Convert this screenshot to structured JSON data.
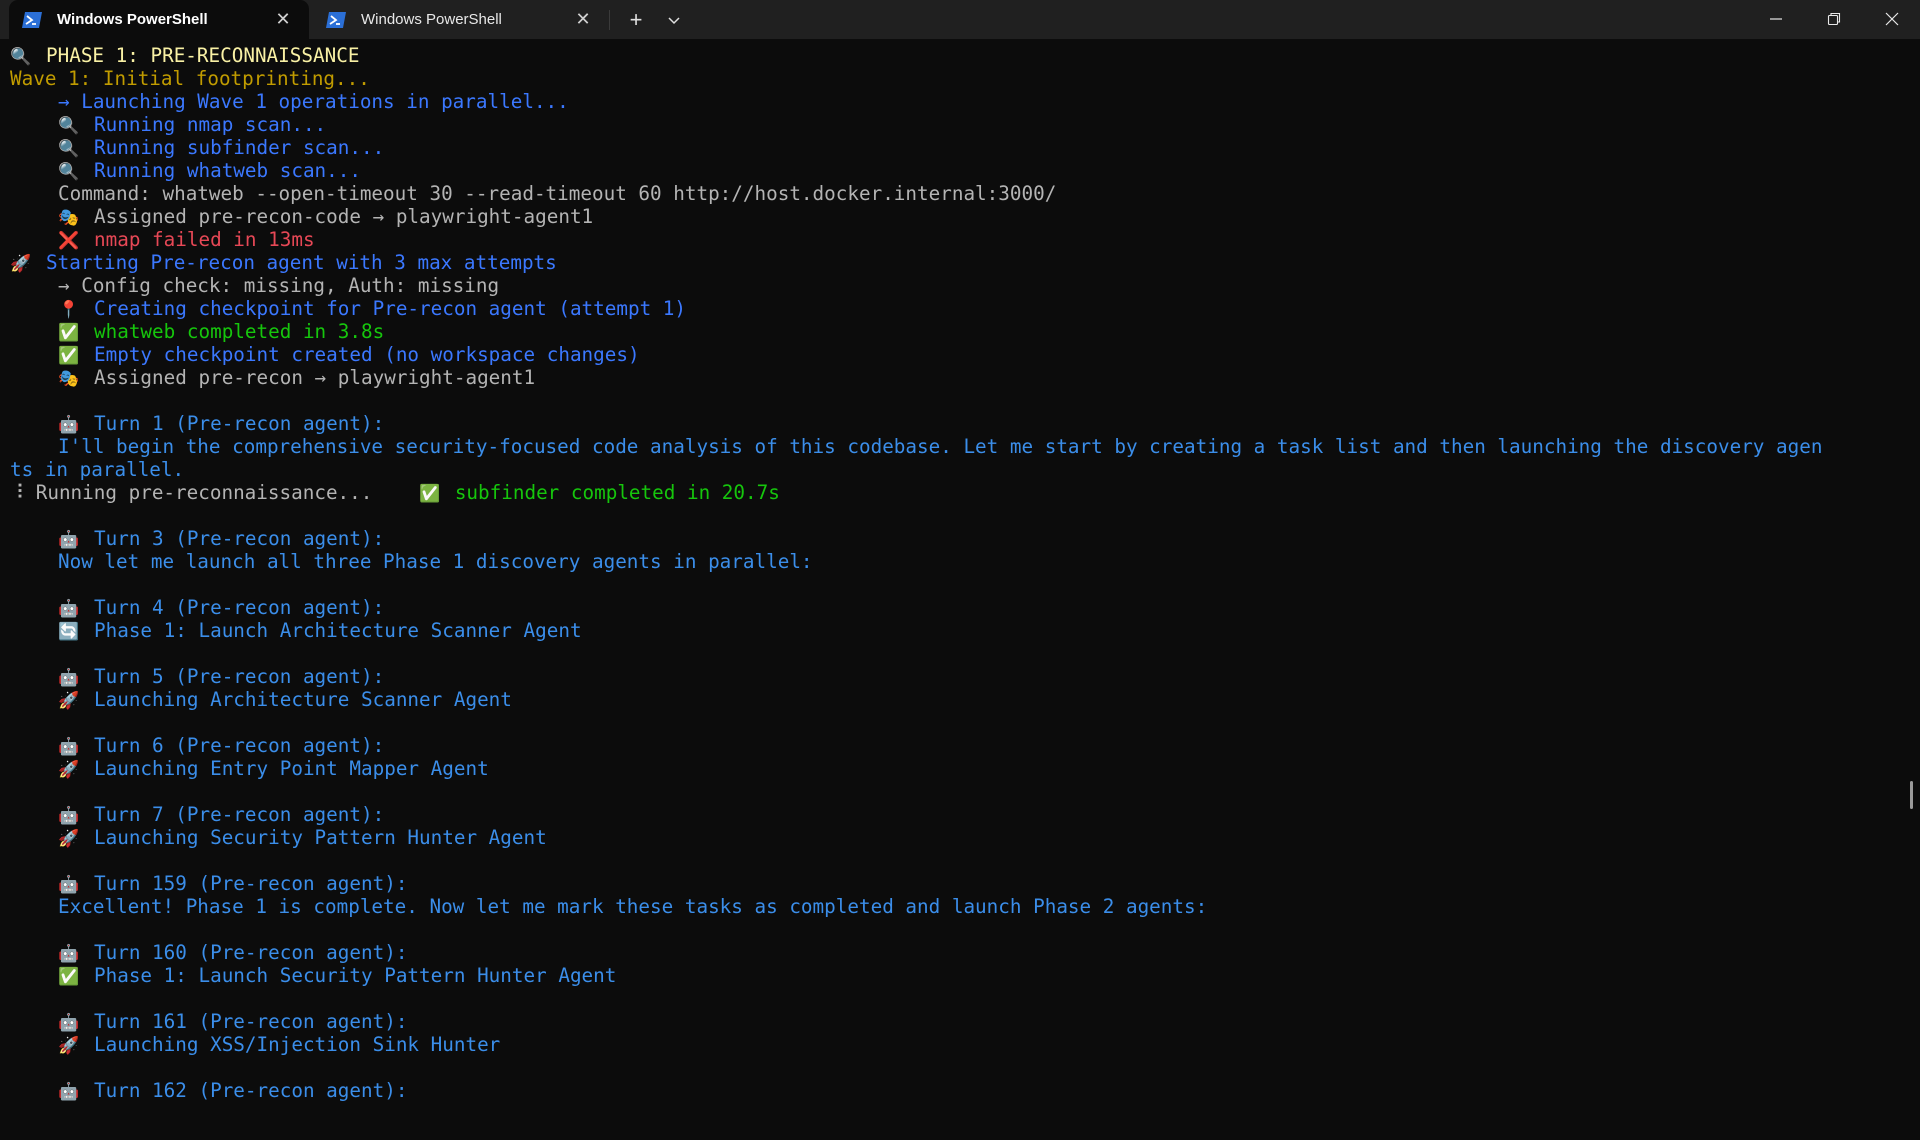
{
  "window": {
    "tabs": [
      {
        "label": "Windows PowerShell",
        "active": true
      },
      {
        "label": "Windows PowerShell",
        "active": false
      }
    ],
    "new_tab": "+",
    "dropdown": "⌄",
    "controls": {
      "minimize": "—",
      "maximize": "❐",
      "close": "✕"
    }
  },
  "colors": {
    "background": "#0c0c0c",
    "titlebar": "#202020",
    "accent_blue": "#3b78ff",
    "error_red": "#e74856",
    "success_green": "#16c60c"
  },
  "terminal": {
    "lines": [
      {
        "icon": "🔍",
        "icon_name": "magnifier-icon",
        "text": "PHASE 1: PRE-RECONNAISSANCE",
        "color": "yellow",
        "indent": false
      },
      {
        "icon": "",
        "text": "Wave 1: Initial footprinting...",
        "color": "orange",
        "indent": false
      },
      {
        "icon": "",
        "text": "→ Launching Wave 1 operations in parallel...",
        "color": "blue",
        "indent": true
      },
      {
        "icon": "🔍",
        "icon_name": "magnifier-icon",
        "text": "Running nmap scan...",
        "color": "blue",
        "indent": true
      },
      {
        "icon": "🔍",
        "icon_name": "magnifier-icon",
        "text": "Running subfinder scan...",
        "color": "blue",
        "indent": true
      },
      {
        "icon": "🔍",
        "icon_name": "magnifier-icon",
        "text": "Running whatweb scan...",
        "color": "blue",
        "indent": true
      },
      {
        "icon": "",
        "text": "Command: whatweb --open-timeout 30 --read-timeout 60 http://host.docker.internal:3000/",
        "color": "dim",
        "indent": true
      },
      {
        "icon": "🎭",
        "icon_name": "theater-masks-icon",
        "text": "Assigned pre-recon-code → playwright-agent1",
        "color": "dim",
        "indent": true
      },
      {
        "icon": "❌",
        "icon_name": "cross-mark-icon",
        "text": "nmap failed in 13ms",
        "color": "red",
        "indent": true
      },
      {
        "icon": "🚀",
        "icon_name": "rocket-icon",
        "text": "Starting Pre-recon agent with 3 max attempts",
        "color": "blue",
        "indent": false
      },
      {
        "icon": "",
        "text": "→ Config check: missing, Auth: missing",
        "color": "dim",
        "indent": true
      },
      {
        "icon": "📍",
        "icon_name": "pin-icon",
        "text": "Creating checkpoint for Pre-recon agent (attempt 1)",
        "color": "blue",
        "indent": true
      },
      {
        "icon": "✅",
        "icon_name": "check-mark-icon",
        "text": "whatweb completed in 3.8s",
        "color": "green",
        "indent": true
      },
      {
        "icon": "✅",
        "icon_name": "check-mark-icon",
        "text": "Empty checkpoint created (no workspace changes)",
        "color": "blue",
        "indent": true
      },
      {
        "icon": "🎭",
        "icon_name": "theater-masks-icon",
        "text": "Assigned pre-recon → playwright-agent1",
        "color": "dim",
        "indent": true
      },
      {
        "icon": "",
        "text": "",
        "color": "dim",
        "indent": false
      },
      {
        "icon": "🤖",
        "icon_name": "robot-icon",
        "text": "Turn 1 (Pre-recon agent):",
        "color": "turnblue",
        "indent": true
      },
      {
        "icon": "",
        "text": "I'll begin the comprehensive security-focused code analysis of this codebase. Let me start by creating a task list and then launching the discovery agen",
        "color": "turnblue",
        "indent": true
      },
      {
        "icon": "",
        "text": "ts in parallel.",
        "color": "turnblue",
        "indent": false
      },
      {
        "icon": "",
        "text": "⠸ Running pre-reconnaissance...    ",
        "color": "dim",
        "indent": false,
        "suffix_icon": "✅",
        "suffix_icon_name": "check-mark-icon",
        "suffix": "subfinder completed in 20.7s",
        "suffix_color": "green"
      },
      {
        "icon": "",
        "text": "",
        "color": "dim",
        "indent": false
      },
      {
        "icon": "🤖",
        "icon_name": "robot-icon",
        "text": "Turn 3 (Pre-recon agent):",
        "color": "turnblue",
        "indent": true
      },
      {
        "icon": "",
        "text": "Now let me launch all three Phase 1 discovery agents in parallel:",
        "color": "turnblue",
        "indent": true
      },
      {
        "icon": "",
        "text": "",
        "color": "dim",
        "indent": false
      },
      {
        "icon": "🤖",
        "icon_name": "robot-icon",
        "text": "Turn 4 (Pre-recon agent):",
        "color": "turnblue",
        "indent": true
      },
      {
        "icon": "🔄",
        "icon_name": "refresh-icon",
        "text": "Phase 1: Launch Architecture Scanner Agent",
        "color": "turnblue",
        "indent": true
      },
      {
        "icon": "",
        "text": "",
        "color": "dim",
        "indent": false
      },
      {
        "icon": "🤖",
        "icon_name": "robot-icon",
        "text": "Turn 5 (Pre-recon agent):",
        "color": "turnblue",
        "indent": true
      },
      {
        "icon": "🚀",
        "icon_name": "rocket-icon",
        "text": "Launching Architecture Scanner Agent",
        "color": "turnblue",
        "indent": true
      },
      {
        "icon": "",
        "text": "",
        "color": "dim",
        "indent": false
      },
      {
        "icon": "🤖",
        "icon_name": "robot-icon",
        "text": "Turn 6 (Pre-recon agent):",
        "color": "turnblue",
        "indent": true
      },
      {
        "icon": "🚀",
        "icon_name": "rocket-icon",
        "text": "Launching Entry Point Mapper Agent",
        "color": "turnblue",
        "indent": true
      },
      {
        "icon": "",
        "text": "",
        "color": "dim",
        "indent": false
      },
      {
        "icon": "🤖",
        "icon_name": "robot-icon",
        "text": "Turn 7 (Pre-recon agent):",
        "color": "turnblue",
        "indent": true
      },
      {
        "icon": "🚀",
        "icon_name": "rocket-icon",
        "text": "Launching Security Pattern Hunter Agent",
        "color": "turnblue",
        "indent": true
      },
      {
        "icon": "",
        "text": "",
        "color": "dim",
        "indent": false
      },
      {
        "icon": "🤖",
        "icon_name": "robot-icon",
        "text": "Turn 159 (Pre-recon agent):",
        "color": "turnblue",
        "indent": true
      },
      {
        "icon": "",
        "text": "Excellent! Phase 1 is complete. Now let me mark these tasks as completed and launch Phase 2 agents:",
        "color": "turnblue",
        "indent": true
      },
      {
        "icon": "",
        "text": "",
        "color": "dim",
        "indent": false
      },
      {
        "icon": "🤖",
        "icon_name": "robot-icon",
        "text": "Turn 160 (Pre-recon agent):",
        "color": "turnblue",
        "indent": true
      },
      {
        "icon": "✅",
        "icon_name": "check-mark-icon",
        "text": "Phase 1: Launch Security Pattern Hunter Agent",
        "color": "turnblue",
        "indent": true
      },
      {
        "icon": "",
        "text": "",
        "color": "dim",
        "indent": false
      },
      {
        "icon": "🤖",
        "icon_name": "robot-icon",
        "text": "Turn 161 (Pre-recon agent):",
        "color": "turnblue",
        "indent": true
      },
      {
        "icon": "🚀",
        "icon_name": "rocket-icon",
        "text": "Launching XSS/Injection Sink Hunter",
        "color": "turnblue",
        "indent": true
      },
      {
        "icon": "",
        "text": "",
        "color": "dim",
        "indent": false
      },
      {
        "icon": "🤖",
        "icon_name": "robot-icon",
        "text": "Turn 162 (Pre-recon agent):",
        "color": "turnblue",
        "indent": true
      }
    ]
  }
}
